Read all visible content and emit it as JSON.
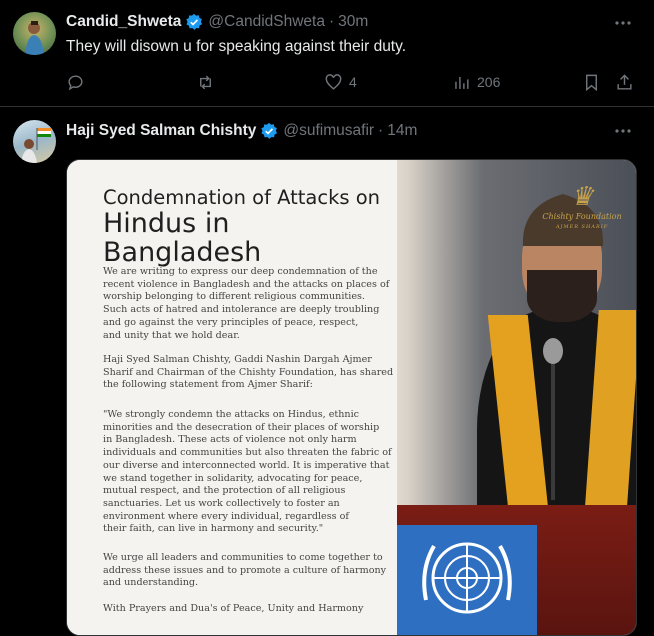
{
  "tweets": [
    {
      "name": "Candid_Shweta",
      "handle": "@CandidShweta",
      "time": "30m",
      "text": "They will disown u for speaking against their duty.",
      "actions": {
        "replies": "",
        "retweets": "",
        "likes": "4",
        "views": "206"
      }
    },
    {
      "name": "Haji Syed Salman Chishty",
      "handle": "@sufimusafir",
      "time": "14m",
      "image": {
        "title_line1": "Condemnation of Attacks on",
        "title_line2": "Hindus in Bangladesh",
        "paragraphs": [
          "We are writing to express our deep condemnation of the\nrecent violence in Bangladesh and the attacks on places of\nworship belonging to different religious communities.\nSuch acts of hatred and intolerance are deeply troubling\nand go against the very principles of peace, respect,\nand unity that we hold dear.",
          "Haji Syed Salman Chishty, Gaddi Nashin Dargah Ajmer\nSharif and Chairman of the Chishty Foundation, has shared\nthe following statement from Ajmer Sharif:",
          "\"We strongly condemn the attacks on Hindus, ethnic\nminorities and the desecration of their places of worship\nin Bangladesh. These acts of violence not only harm\nindividuals and communities but also threaten the fabric of\nour diverse and interconnected world. It is imperative that\nwe stand together in solidarity, advocating for peace,\nmutual respect, and the protection of all religious\nsanctuaries. Let us work collectively to foster an\nenvironment where every individual, regardless of\ntheir faith, can live in harmony and security.\"",
          "We urge all leaders and communities to come together to\naddress these issues and to promote a culture of harmony\nand understanding.",
          "With Prayers and Dua's of Peace, Unity and Harmony"
        ],
        "brand_text": "Chishty Foundation",
        "brand_sub": "AJMER SHARIF"
      }
    }
  ],
  "colors": {
    "background": "#000000",
    "text": "#e7e9ea",
    "muted": "#71767b",
    "verified": "#1d9bf0",
    "divider": "#2f3336"
  }
}
